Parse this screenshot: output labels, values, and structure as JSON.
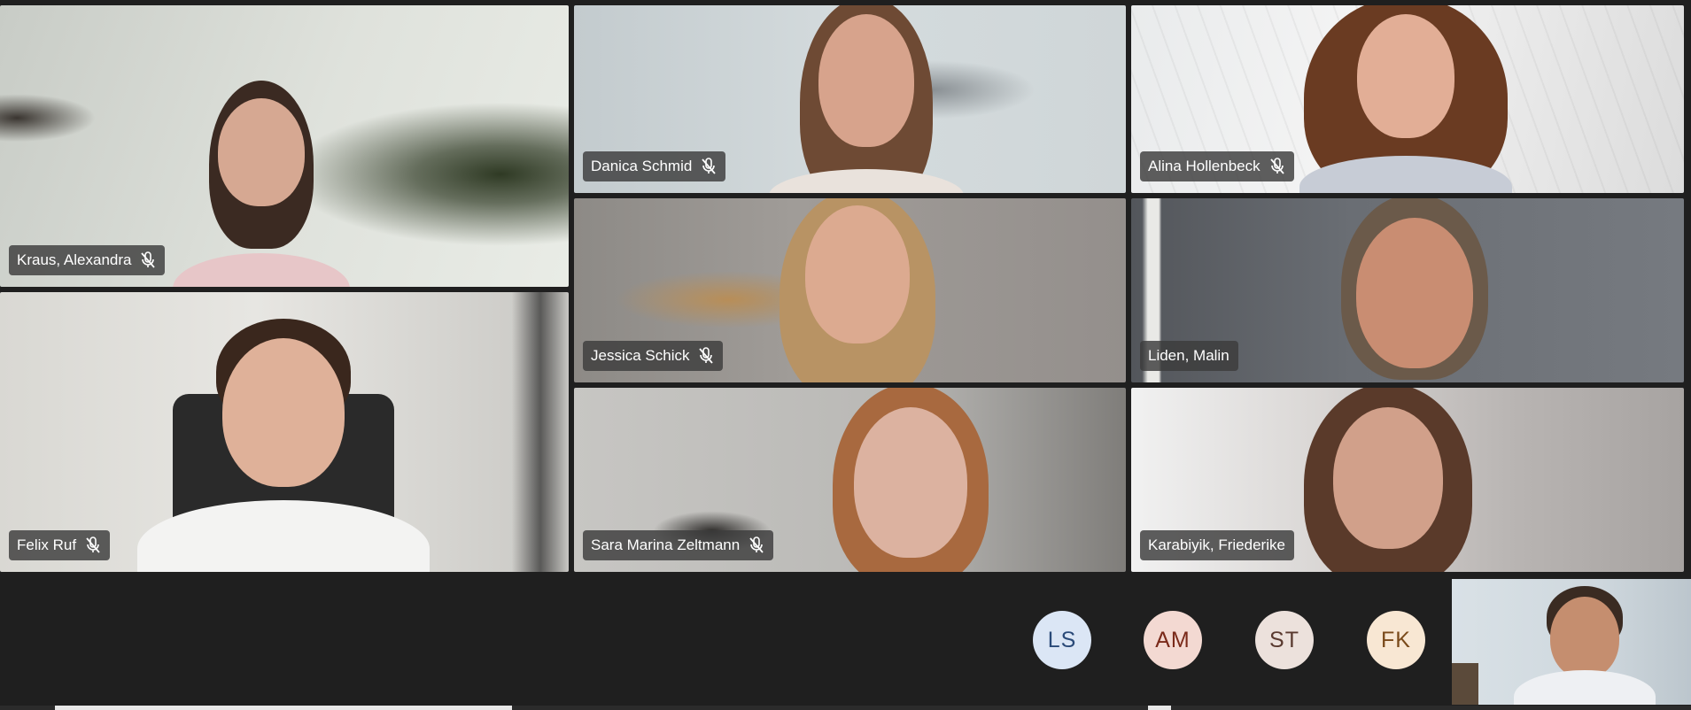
{
  "participants": [
    {
      "name": "Kraus, Alexandra",
      "muted": true
    },
    {
      "name": "Danica Schmid",
      "muted": true
    },
    {
      "name": "Alina Hollenbeck",
      "muted": true
    },
    {
      "name": "Felix Ruf",
      "muted": true
    },
    {
      "name": "Jessica Schick",
      "muted": true
    },
    {
      "name": "Liden, Malin",
      "muted": false
    },
    {
      "name": "Sara Marina Zeltmann",
      "muted": true
    },
    {
      "name": "Karabiyik, Friederike",
      "muted": false
    }
  ],
  "audio_only": [
    {
      "initials": "LS",
      "bg": "#dbe6f5",
      "fg": "#2a4a78"
    },
    {
      "initials": "AM",
      "bg": "#f3d9d2",
      "fg": "#7a2a1a"
    },
    {
      "initials": "ST",
      "bg": "#ece1dc",
      "fg": "#5a3a30"
    },
    {
      "initials": "FK",
      "bg": "#f8e7d3",
      "fg": "#7a4a1a"
    }
  ],
  "icons": {
    "muted_mic": "mic-off-icon"
  }
}
